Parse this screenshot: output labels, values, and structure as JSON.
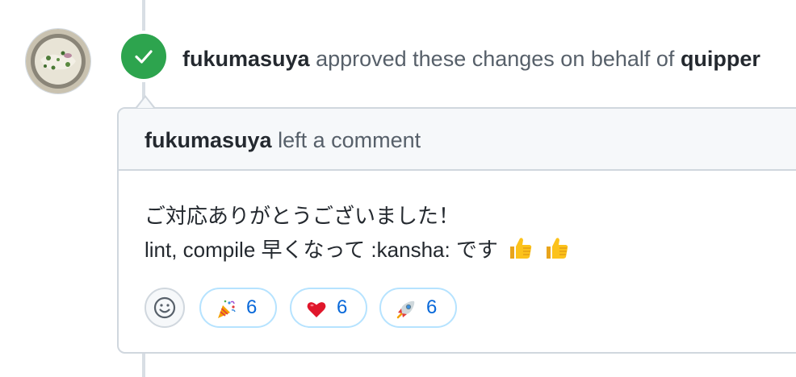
{
  "event": {
    "actor": "fukumasuya",
    "action_text": "approved these changes on behalf of",
    "org": "quipper",
    "status_icon": "check-icon",
    "status_color": "#2da44e"
  },
  "comment": {
    "author": "fukumasuya",
    "header_action": "left a comment",
    "body_line1": "ご対応ありがとうございました！",
    "body_line2": "lint, compile 早くなって :kansha: です",
    "body_emojis": [
      "thumbs-up-icon",
      "thumbs-up-icon"
    ]
  },
  "reactions": [
    {
      "icon": "party-popper-icon",
      "count": "6"
    },
    {
      "icon": "heart-icon",
      "count": "6"
    },
    {
      "icon": "rocket-icon",
      "count": "6"
    }
  ],
  "colors": {
    "accent": "#0969da",
    "border": "#d0d7de",
    "header_bg": "#f6f8fa",
    "reaction_border": "#b6e3ff"
  }
}
